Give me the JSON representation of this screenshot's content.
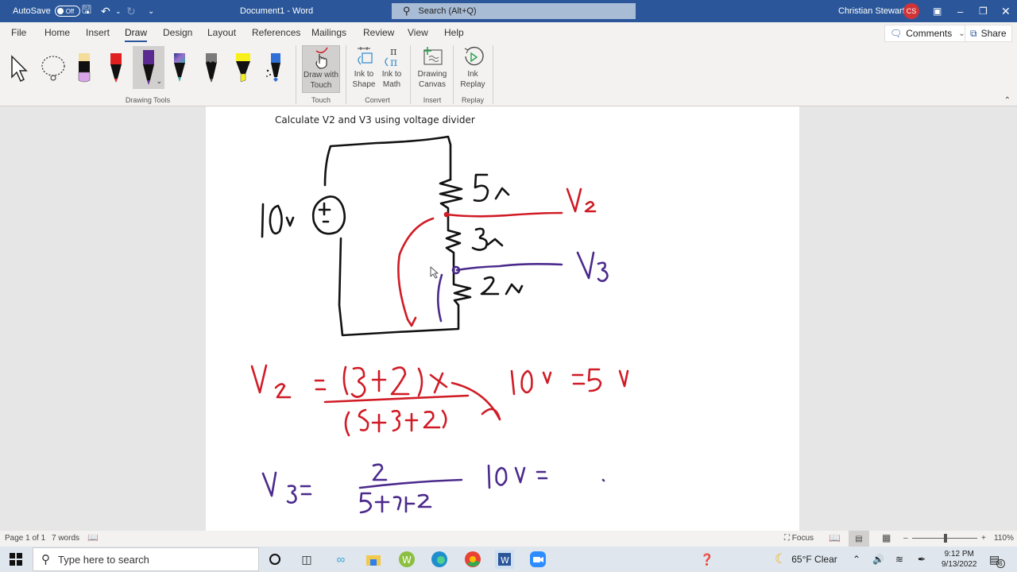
{
  "titlebar": {
    "autosave_label": "AutoSave",
    "autosave_state": "Off",
    "doc_title": "Document1  -  Word",
    "search_placeholder": "Search (Alt+Q)",
    "user_name": "Christian Stewart",
    "user_initials": "CS"
  },
  "tabs": [
    "File",
    "Home",
    "Insert",
    "Draw",
    "Design",
    "Layout",
    "References",
    "Mailings",
    "Review",
    "View",
    "Help"
  ],
  "active_tab": "Draw",
  "header_buttons": {
    "comments": "Comments",
    "share": "Share"
  },
  "ribbon": {
    "groups": {
      "drawing_tools": "Drawing Tools",
      "touch": "Touch",
      "convert": "Convert",
      "insert": "Insert",
      "replay": "Replay"
    },
    "buttons": {
      "draw_with_touch_1": "Draw with",
      "draw_with_touch_2": "Touch",
      "ink_to_shape_1": "Ink to",
      "ink_to_shape_2": "Shape",
      "ink_to_math_1": "Ink to",
      "ink_to_math_2": "Math",
      "drawing_canvas_1": "Drawing",
      "drawing_canvas_2": "Canvas",
      "ink_replay_1": "Ink",
      "ink_replay_2": "Replay"
    },
    "pen_colors": {
      "highlighter_pink": "#d8a6e8",
      "red": "#e02020",
      "purple": "#5b2a91",
      "galaxy": "#3aa6a6",
      "pencil": "#7a7a7a",
      "highlighter_yellow": "#f7f01a",
      "action_pen": "#2f6fd6"
    }
  },
  "document": {
    "heading": "Calculate V2 and V3 using voltage divider",
    "ink": {
      "source_label": "10v",
      "resistors": [
        "5Ω",
        "3Ω",
        "2Ω"
      ],
      "v2_label": "V2",
      "v3_label": "V3",
      "eq1": "V2 = (3+2)/(5+3+2) × 10v = 5v",
      "eq2": "V3 = 2/(5+3+2) 10v = ."
    },
    "ink_colors": {
      "black": "#111111",
      "red": "#d01b25",
      "purple": "#4b2a8c"
    }
  },
  "statusbar": {
    "page": "Page 1 of 1",
    "words": "7 words",
    "focus": "Focus",
    "zoom": "110%"
  },
  "taskbar": {
    "search_placeholder": "Type here to search",
    "weather": "65°F  Clear",
    "time": "9:12 PM",
    "date": "9/13/2022",
    "notifications": "6"
  }
}
